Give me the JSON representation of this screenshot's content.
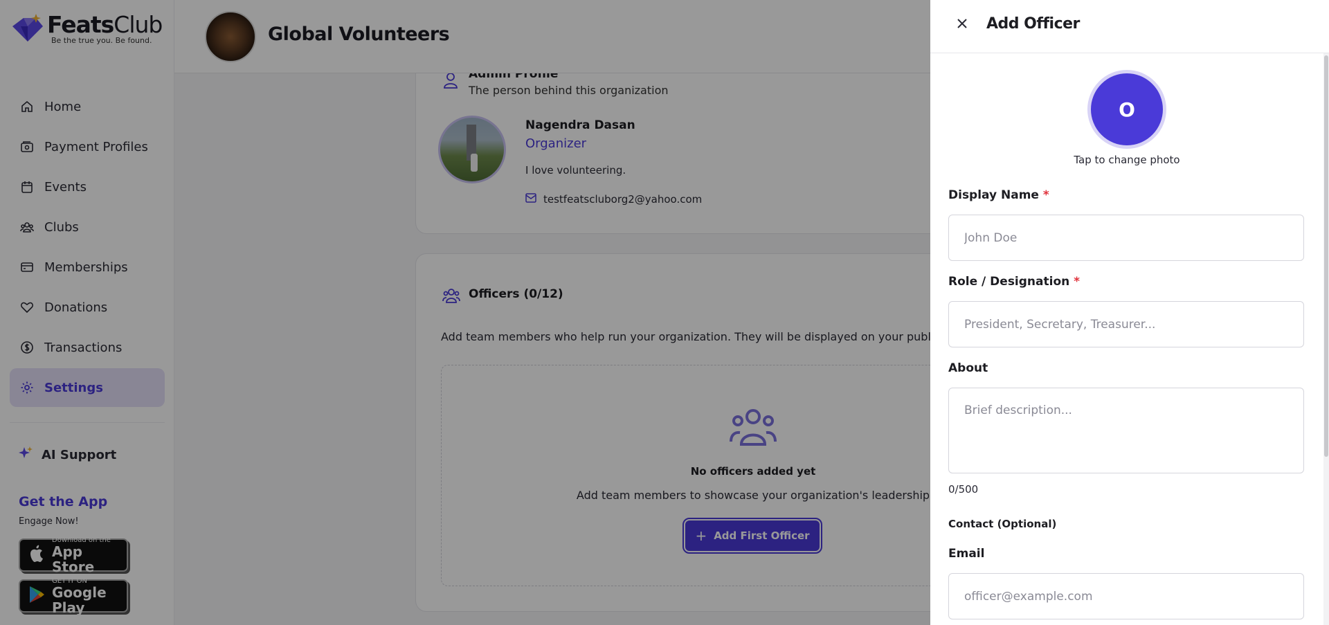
{
  "brand": {
    "name_bold": "Feats",
    "name_light": "Club",
    "tagline": "Be the true you. Be found.",
    "accent_color": "#4a3ad8"
  },
  "sidebar": {
    "items": [
      {
        "label": "Home",
        "icon": "home-icon"
      },
      {
        "label": "Payment Profiles",
        "icon": "wallet-icon"
      },
      {
        "label": "Events",
        "icon": "calendar-icon"
      },
      {
        "label": "Clubs",
        "icon": "users-icon"
      },
      {
        "label": "Memberships",
        "icon": "card-icon"
      },
      {
        "label": "Donations",
        "icon": "heart-icon"
      },
      {
        "label": "Transactions",
        "icon": "dollar-icon"
      },
      {
        "label": "Settings",
        "icon": "gear-icon",
        "active": true
      }
    ],
    "ai_support": "AI Support",
    "get_app_title": "Get the App",
    "engage": "Engage Now!",
    "app_store_small": "Download on the",
    "app_store_big": "App Store",
    "google_play_small": "GET IT ON",
    "google_play_big": "Google Play"
  },
  "header": {
    "org_name": "Global Volunteers"
  },
  "admin_profile": {
    "title": "Admin Profile",
    "subtitle": "The person behind this organization",
    "name": "Nagendra Dasan",
    "role": "Organizer",
    "bio": "I love volunteering.",
    "email": "testfeatscluborg2@yahoo.com"
  },
  "officers": {
    "title": "Officers (0/12)",
    "description": "Add team members who help run your organization. They will be displayed on your public profile.",
    "empty_title": "No officers added yet",
    "empty_sub": "Add team members to showcase your organization's leadership",
    "add_button": "Add First Officer"
  },
  "drawer": {
    "title": "Add Officer",
    "photo_initial": "O",
    "photo_caption": "Tap to change photo",
    "display_name_label": "Display Name",
    "display_name_placeholder": "John Doe",
    "role_label": "Role / Designation",
    "role_placeholder": "President, Secretary, Treasurer...",
    "about_label": "About",
    "about_placeholder": "Brief description...",
    "char_count": "0/500",
    "contact_label": "Contact (Optional)",
    "email_label": "Email",
    "email_placeholder": "officer@example.com",
    "required_mark": "*"
  }
}
